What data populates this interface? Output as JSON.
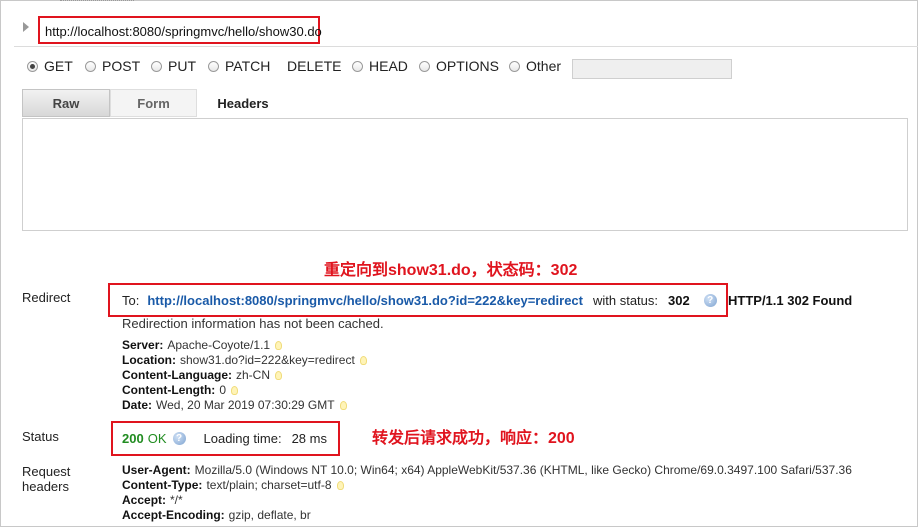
{
  "request": {
    "url": "http://localhost:8080/springmvc/hello/show30.do",
    "methods": [
      {
        "label": "GET",
        "checked": true
      },
      {
        "label": "POST",
        "checked": false
      },
      {
        "label": "PUT",
        "checked": false
      },
      {
        "label": "PATCH",
        "checked": false
      },
      {
        "label": "DELETE",
        "checked": false
      },
      {
        "label": "HEAD",
        "checked": false
      },
      {
        "label": "OPTIONS",
        "checked": false
      },
      {
        "label": "Other",
        "checked": false
      }
    ],
    "other_value": "",
    "tabs": {
      "raw": "Raw",
      "form": "Form",
      "headers": "Headers"
    },
    "raw_headers": ""
  },
  "annotations": {
    "redirect_note": "重定向到show31.do，状态码：302",
    "status_note": "转发后请求成功，响应：200"
  },
  "response": {
    "redirect": {
      "label": "Redirect",
      "to_label": "To:",
      "to_url": "http://localhost:8080/springmvc/hello/show31.do?id=222&key=redirect",
      "with_status_label": "with status:",
      "status_code": "302",
      "status_line": "HTTP/1.1 302 Found",
      "cache_note": "Redirection information has not been cached.",
      "headers": [
        {
          "name": "Server:",
          "value": "Apache-Coyote/1.1"
        },
        {
          "name": "Location:",
          "value": "show31.do?id=222&key=redirect"
        },
        {
          "name": "Content-Language:",
          "value": "zh-CN"
        },
        {
          "name": "Content-Length:",
          "value": "0"
        },
        {
          "name": "Date:",
          "value": "Wed, 20 Mar 2019 07:30:29 GMT"
        }
      ]
    },
    "status": {
      "label": "Status",
      "code": "200",
      "text": "OK",
      "loading_label": "Loading time:",
      "loading_value": "28 ms"
    },
    "request_headers": {
      "label_line1": "Request",
      "label_line2": "headers",
      "headers": [
        {
          "name": "User-Agent:",
          "value": "Mozilla/5.0 (Windows NT 10.0; Win64; x64) AppleWebKit/537.36 (KHTML, like Gecko) Chrome/69.0.3497.100 Safari/537.36"
        },
        {
          "name": "Content-Type:",
          "value": "text/plain; charset=utf-8"
        },
        {
          "name": "Accept:",
          "value": "*/*"
        },
        {
          "name": "Accept-Encoding:",
          "value": "gzip, deflate, br"
        }
      ]
    }
  },
  "colors": {
    "highlight_red": "#e0141e",
    "link_blue": "#1a5aa8",
    "ok_green": "#218c21"
  }
}
